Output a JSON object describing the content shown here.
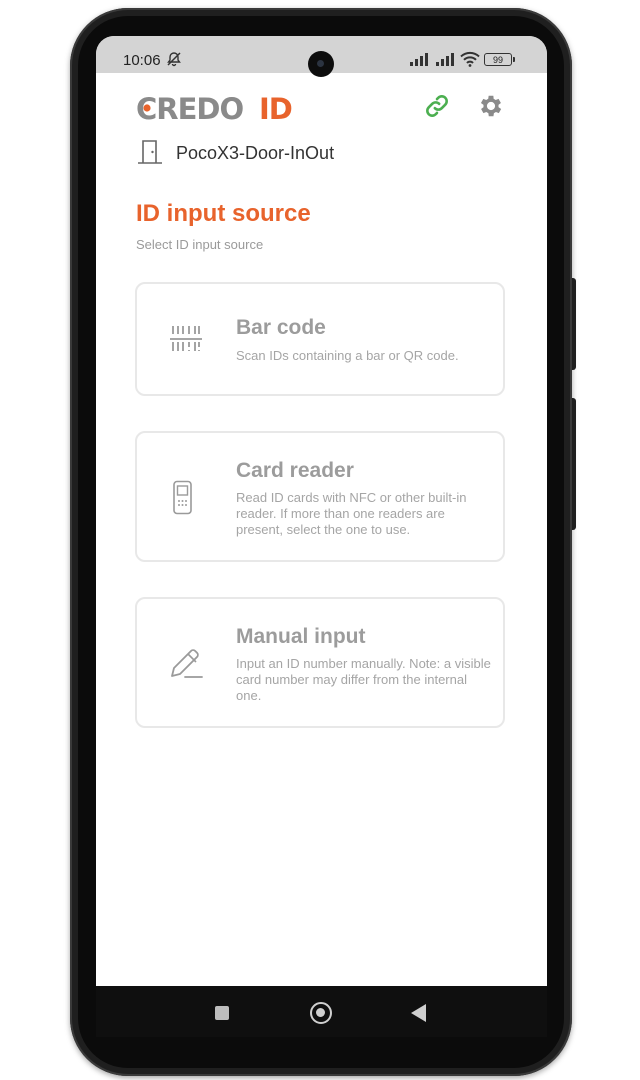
{
  "status_bar": {
    "time": "10:06",
    "battery": "99"
  },
  "header": {
    "logo_text_left": "CREDO",
    "logo_text_right": "ID",
    "link_icon": "link-icon",
    "settings_icon": "gear-icon"
  },
  "device": {
    "name": "PocoX3-Door-InOut",
    "icon": "door-icon"
  },
  "section": {
    "title": "ID input source",
    "subtitle": "Select ID input source"
  },
  "options": [
    {
      "title": "Bar code",
      "description": "Scan IDs containing a bar or QR code.",
      "icon": "barcode-icon"
    },
    {
      "title": "Card reader",
      "description": "Read ID cards with NFC or other built-in reader. If more than one readers are present, select the one to use.",
      "icon": "card-reader-icon"
    },
    {
      "title": "Manual input",
      "description": "Input an ID number manually. Note: a visible card number may differ from the internal one.",
      "icon": "pencil-icon"
    }
  ],
  "colors": {
    "accent": "#e8632c",
    "logo_gray": "#8a8a8a",
    "link_green": "#4caf50",
    "status_bar": "#d4d4d4"
  }
}
